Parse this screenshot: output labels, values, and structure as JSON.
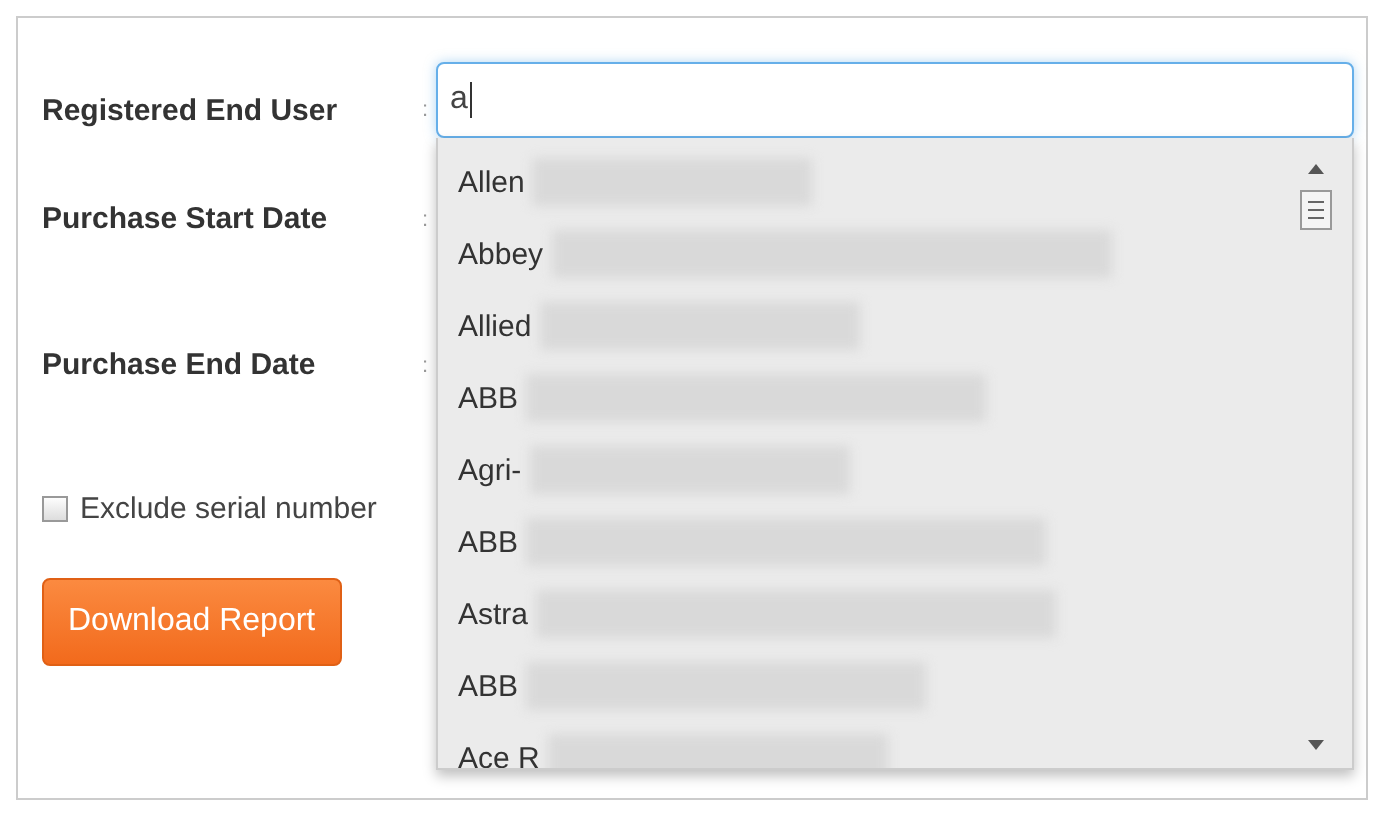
{
  "form": {
    "fields": [
      {
        "label": "Registered End User",
        "separator": ":"
      },
      {
        "label": "Purchase Start Date",
        "separator": ":"
      },
      {
        "label": "Purchase End Date",
        "separator": ":"
      }
    ],
    "search": {
      "value": "a"
    },
    "exclude": {
      "label": "Exclude serial number",
      "checked": false
    },
    "button": "Download Report"
  },
  "suggestions": [
    {
      "text": "Allen"
    },
    {
      "text": "Abbey"
    },
    {
      "text": "Allied"
    },
    {
      "text": "ABB"
    },
    {
      "text": "Agri-"
    },
    {
      "text": "ABB"
    },
    {
      "text": "Astra"
    },
    {
      "text": "ABB"
    },
    {
      "text": "Ace R"
    }
  ]
}
